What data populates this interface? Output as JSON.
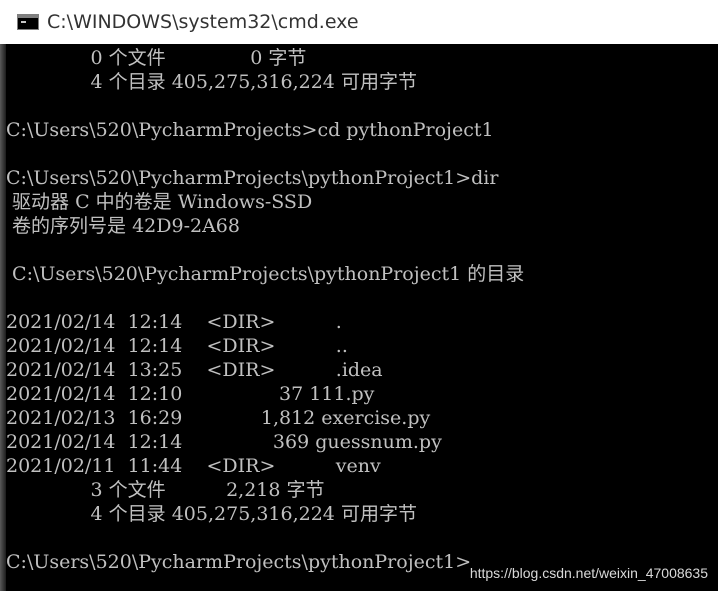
{
  "window": {
    "title": "C:\\WINDOWS\\system32\\cmd.exe",
    "icon": "console-icon"
  },
  "console": {
    "lines": [
      "              0 个文件              0 字节",
      "              4 个目录 405,275,316,224 可用字节",
      "",
      "C:\\Users\\520\\PycharmProjects>cd pythonProject1",
      "",
      "C:\\Users\\520\\PycharmProjects\\pythonProject1>dir",
      " 驱动器 C 中的卷是 Windows-SSD",
      " 卷的序列号是 42D9-2A68",
      "",
      " C:\\Users\\520\\PycharmProjects\\pythonProject1 的目录",
      "",
      "2021/02/14  12:14    <DIR>          .",
      "2021/02/14  12:14    <DIR>          ..",
      "2021/02/14  13:25    <DIR>          .idea",
      "2021/02/14  12:10                37 111.py",
      "2021/02/13  16:29             1,812 exercise.py",
      "2021/02/14  12:14               369 guessnum.py",
      "2021/02/11  11:44    <DIR>          venv",
      "              3 个文件          2,218 字节",
      "              4 个目录 405,275,316,224 可用字节",
      "",
      "C:\\Users\\520\\PycharmProjects\\pythonProject1>"
    ]
  },
  "watermark": "https://blog.csdn.net/weixin_47008635",
  "colors": {
    "console_bg": "#000000",
    "console_text": "#c0c0c0",
    "titlebar_bg": "#ffffff",
    "title_text": "#333333"
  }
}
